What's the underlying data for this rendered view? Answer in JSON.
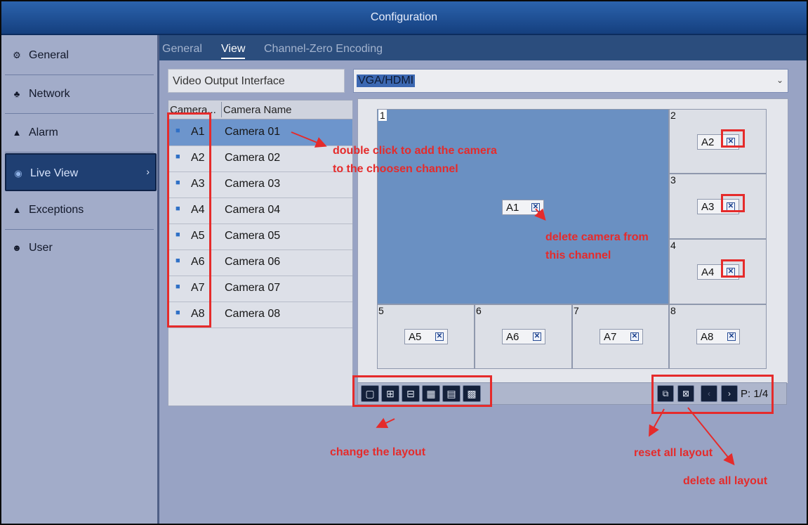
{
  "window": {
    "title": "Configuration"
  },
  "sidebar": {
    "items": [
      {
        "label": "General",
        "icon": "gear-icon",
        "active": false
      },
      {
        "label": "Network",
        "icon": "network-icon",
        "active": false
      },
      {
        "label": "Alarm",
        "icon": "alarm-icon",
        "active": false
      },
      {
        "label": "Live View",
        "icon": "live-view-icon",
        "active": true
      },
      {
        "label": "Exceptions",
        "icon": "warning-icon",
        "active": false
      },
      {
        "label": "User",
        "icon": "users-icon",
        "active": false
      }
    ]
  },
  "tabs": [
    {
      "label": "General",
      "active": false
    },
    {
      "label": "View",
      "active": true
    },
    {
      "label": "Channel-Zero Encoding",
      "active": false
    }
  ],
  "video_output": {
    "label": "Video Output Interface",
    "value": "VGA/HDMI"
  },
  "camera_table": {
    "headers": [
      "Camera...",
      "Camera Name"
    ],
    "rows": [
      {
        "id": "A1",
        "name": "Camera 01",
        "selected": true
      },
      {
        "id": "A2",
        "name": "Camera 02",
        "selected": false
      },
      {
        "id": "A3",
        "name": "Camera 03",
        "selected": false
      },
      {
        "id": "A4",
        "name": "Camera 04",
        "selected": false
      },
      {
        "id": "A5",
        "name": "Camera 05",
        "selected": false
      },
      {
        "id": "A6",
        "name": "Camera 06",
        "selected": false
      },
      {
        "id": "A7",
        "name": "Camera 07",
        "selected": false
      },
      {
        "id": "A8",
        "name": "Camera 08",
        "selected": false
      }
    ]
  },
  "channels": [
    {
      "number": "1",
      "camera": "A1"
    },
    {
      "number": "2",
      "camera": "A2"
    },
    {
      "number": "3",
      "camera": "A3"
    },
    {
      "number": "4",
      "camera": "A4"
    },
    {
      "number": "5",
      "camera": "A5"
    },
    {
      "number": "6",
      "camera": "A6"
    },
    {
      "number": "7",
      "camera": "A7"
    },
    {
      "number": "8",
      "camera": "A8"
    }
  ],
  "layout_buttons": [
    "1-window-layout-icon",
    "4-window-layout-icon",
    "6-window-layout-icon",
    "8-window-layout-icon",
    "9-window-layout-icon",
    "16-window-layout-icon"
  ],
  "pager": {
    "text": "P: 1/4",
    "prev": "‹",
    "next": "›"
  },
  "annotations": {
    "double_click": "double click to add the camera\nto the choosen channel",
    "delete_camera": "delete camera from\nthis channel",
    "change_layout": "change the layout",
    "reset_all": "reset all layout",
    "delete_all": "delete all layout"
  },
  "colors": {
    "annotation": "#e52b2b",
    "title_bar": "#1f4f95",
    "active_item": "#1f3f72"
  }
}
